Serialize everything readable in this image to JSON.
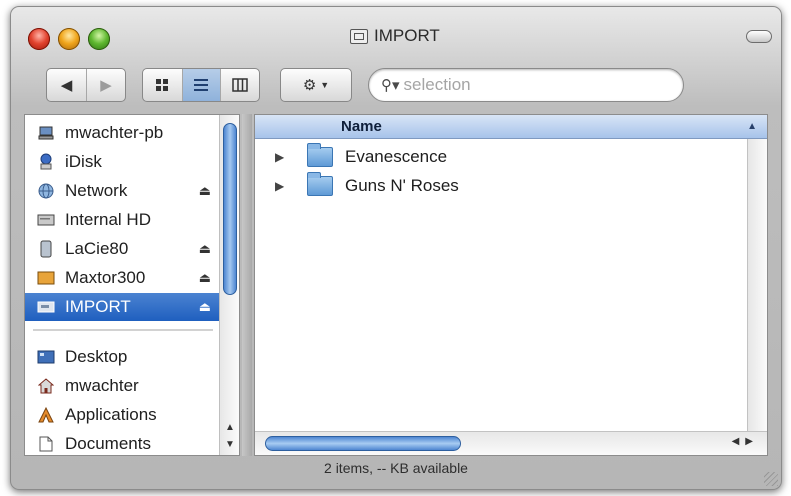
{
  "window": {
    "title": "IMPORT"
  },
  "toolbar": {
    "back_icon": "back-arrow-icon",
    "forward_icon": "forward-arrow-icon",
    "views": [
      "icon-view-icon",
      "list-view-icon",
      "column-view-icon"
    ],
    "active_view": "list-view-icon",
    "action_icon": "gear-icon"
  },
  "search": {
    "placeholder": "selection",
    "value": ""
  },
  "sidebar": {
    "devices": [
      {
        "label": "mwachter-pb",
        "icon": "computer-icon",
        "eject": false
      },
      {
        "label": "iDisk",
        "icon": "idisk-icon",
        "eject": false
      },
      {
        "label": "Network",
        "icon": "network-globe-icon",
        "eject": true
      },
      {
        "label": "Internal HD",
        "icon": "hard-drive-icon",
        "eject": false
      },
      {
        "label": "LaCie80",
        "icon": "external-drive-icon",
        "eject": true
      },
      {
        "label": "Maxtor300",
        "icon": "external-drive-icon",
        "eject": true
      },
      {
        "label": "IMPORT",
        "icon": "disk-image-icon",
        "eject": true,
        "selected": true
      }
    ],
    "places": [
      {
        "label": "Desktop",
        "icon": "desktop-icon"
      },
      {
        "label": "mwachter",
        "icon": "home-icon"
      },
      {
        "label": "Applications",
        "icon": "applications-icon"
      },
      {
        "label": "Documents",
        "icon": "documents-icon"
      }
    ]
  },
  "list": {
    "column_header": "Name",
    "rows": [
      {
        "name": "Evanescence",
        "icon": "folder-icon"
      },
      {
        "name": "Guns N' Roses",
        "icon": "folder-icon"
      }
    ]
  },
  "status": "2 items, -- KB available",
  "colors": {
    "selection": "#1f5fbf",
    "header": "#a7c3ea"
  }
}
